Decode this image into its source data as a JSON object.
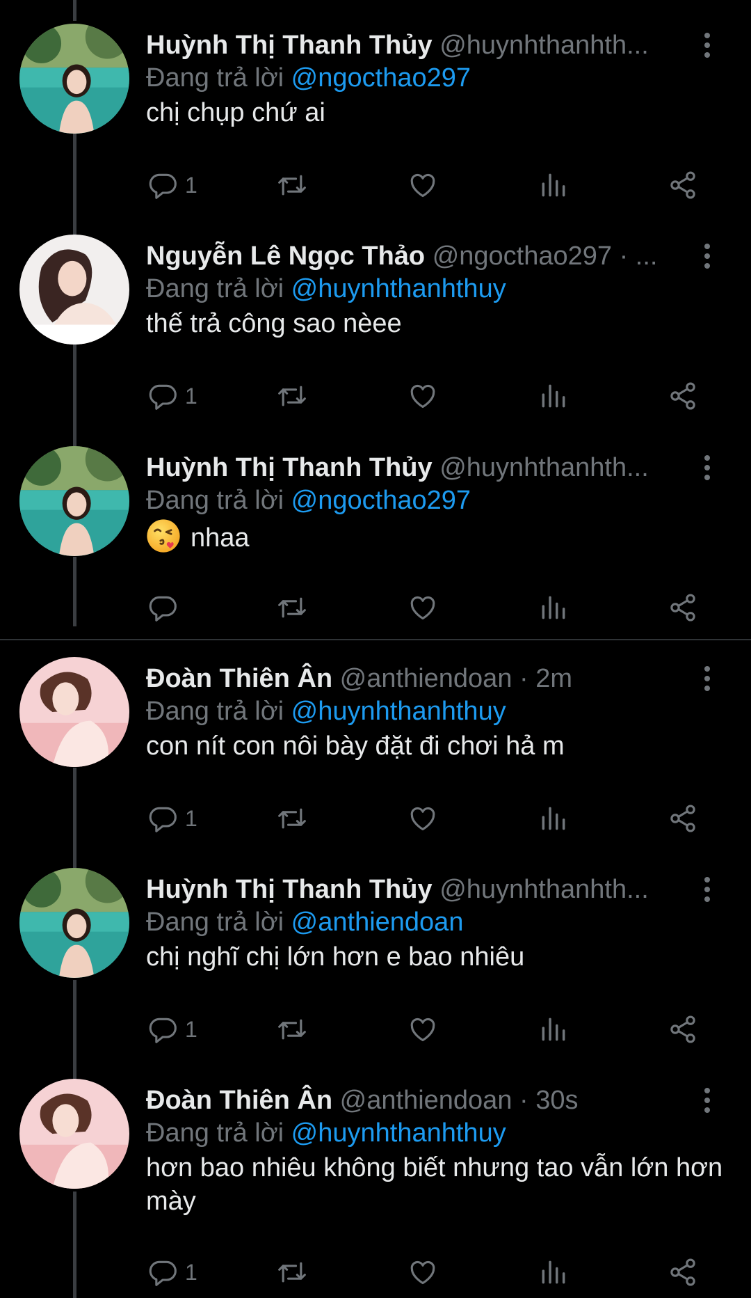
{
  "colors": {
    "background": "#000000",
    "link": "#1d9bf0",
    "muted": "#71767b",
    "text": "#e7e9ea"
  },
  "reply_prefix": "Đang trả lời",
  "tweets": [
    {
      "name": "Huỳnh Thị Thanh Thủy",
      "handle": "@huynhthanhth...",
      "reply_to": "@ngocthao297",
      "text": "chị chụp chứ ai",
      "replies": "1",
      "avatar": "pool-avatar"
    },
    {
      "name": "Nguyễn Lê Ngọc Thảo",
      "handle": "@ngocthao297 · ...",
      "reply_to": "@huynhthanhthuy",
      "text": "thế trả công sao nèee",
      "replies": "1",
      "avatar": "portrait-avatar"
    },
    {
      "name": "Huỳnh Thị Thanh Thủy",
      "handle": "@huynhthanhth...",
      "reply_to": "@ngocthao297",
      "text": "nhaa",
      "emoji": "kissing-face-emoji",
      "replies": "",
      "avatar": "pool-avatar"
    },
    {
      "name": "Đoàn Thiên Ân",
      "handle": "@anthiendoan · 2m",
      "reply_to": "@huynhthanhthuy",
      "text": "con nít con nôi bày đặt đi chơi hả m",
      "replies": "1",
      "avatar": "pink-avatar"
    },
    {
      "name": "Huỳnh Thị Thanh Thủy",
      "handle": "@huynhthanhth...",
      "reply_to": "@anthiendoan",
      "text": "chị nghĩ chị lớn hơn e bao nhiêu",
      "replies": "1",
      "avatar": "pool-avatar"
    },
    {
      "name": "Đoàn Thiên Ân",
      "handle": "@anthiendoan · 30s",
      "reply_to": "@huynhthanhthuy",
      "text": "hơn bao nhiêu không biết nhưng tao vẫn lớn hơn mày",
      "replies": "1",
      "avatar": "pink-avatar"
    }
  ]
}
